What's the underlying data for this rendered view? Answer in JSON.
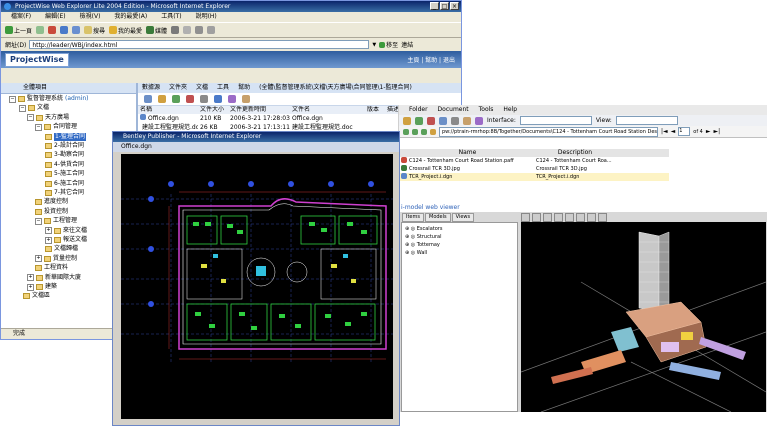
{
  "win1": {
    "title": "ProjectWise Web Explorer Lite 2004 Edition - Microsoft Internet Explorer",
    "menu": [
      "檔案(F)",
      "編輯(E)",
      "檢視(V)",
      "我的最愛(A)",
      "工具(T)",
      "說明(H)"
    ],
    "toolbar": {
      "back": "上一頁",
      "search": "搜尋",
      "favorites": "我的最愛",
      "media": "媒體"
    },
    "address_label": "網址(D)",
    "address_value": "http://leader/WBj/index.html",
    "go_label": "移至",
    "links_label": "連結",
    "logo": "ProjectWise",
    "header_links": "主頁 | 幫助 | 退出",
    "tree_header": "全體項目",
    "tree_user": "(admin)",
    "tree": [
      {
        "label": "監督管理系統",
        "pm": "−"
      },
      {
        "label": "文檔",
        "pm": "−"
      },
      {
        "label": "天方廣場",
        "pm": "−"
      },
      {
        "label": "合同管理",
        "pm": "−"
      },
      {
        "label": "1-監理合同",
        "selected": true
      },
      {
        "label": "2-設計合同"
      },
      {
        "label": "3-勘察合同"
      },
      {
        "label": "4-供貨合同"
      },
      {
        "label": "5-施工合同"
      },
      {
        "label": "6-施工合同"
      },
      {
        "label": "7-其它合同"
      },
      {
        "label": "進度控制"
      },
      {
        "label": "投資控制"
      },
      {
        "label": "工程管理",
        "pm": "−"
      },
      {
        "label": "來往文檔",
        "pm": "+"
      },
      {
        "label": "報送文檔",
        "pm": "+"
      },
      {
        "label": "文檔歸檔"
      },
      {
        "label": "質量控制",
        "pm": "+"
      },
      {
        "label": "工程資料"
      },
      {
        "label": "新華國際大廈",
        "pm": "+"
      },
      {
        "label": "建築",
        "pm": "+"
      },
      {
        "label": "文檔區"
      }
    ],
    "pw_menu": [
      "數據源",
      "文件夾",
      "文檔",
      "工具",
      "幫助",
      "(全體\\監督管理系統\\文檔\\天方廣場\\合同管理\\1-監理合同)"
    ],
    "columns": [
      "名稱",
      "文件大小",
      "文件更新時間",
      "文件名",
      "版本",
      "描述"
    ],
    "files": [
      {
        "name": "Office.dgn",
        "size": "210 KB",
        "time": "2006-3-21 17:28:03",
        "filename": "Office.dgn"
      },
      {
        "name": "建設工程監理規范.doc",
        "size": "26 KB",
        "time": "2006-3-21 17:13:11",
        "filename": "建設工程監理規范.doc"
      }
    ],
    "status": "完成"
  },
  "win2": {
    "title": "Bentley Publisher - Microsoft Internet Explorer",
    "drawing_title": "Office.dgn"
  },
  "win3": {
    "menu": [
      "Folder",
      "Document",
      "Tools",
      "Help"
    ],
    "interface_label": "Interface:",
    "view_label": "View:",
    "path": "pw://ptrain-rmrhop:8B/Together/Documents\\C124 - Tottenham Court Road Station Design\\",
    "page_of": "of 4",
    "columns": [
      "Name",
      "Description"
    ],
    "docs": [
      {
        "name": "C124 - Tottenham Court Road Station.paff",
        "desc": "C124 - Tottenham Court Roa..."
      },
      {
        "name": "Crossrail TCR 3D.jpg",
        "desc": "Crossrail TCR 3D.jpg"
      },
      {
        "name": "TCR_Project.i.dgn",
        "desc": "TCR_Project.i.dgn"
      }
    ],
    "label": "i-model web viewer",
    "viewer_tabs": [
      "Items",
      "Models",
      "Views"
    ],
    "viewer_tree": [
      "Escalators",
      "Structural",
      "Tottemay",
      "Wall"
    ]
  }
}
